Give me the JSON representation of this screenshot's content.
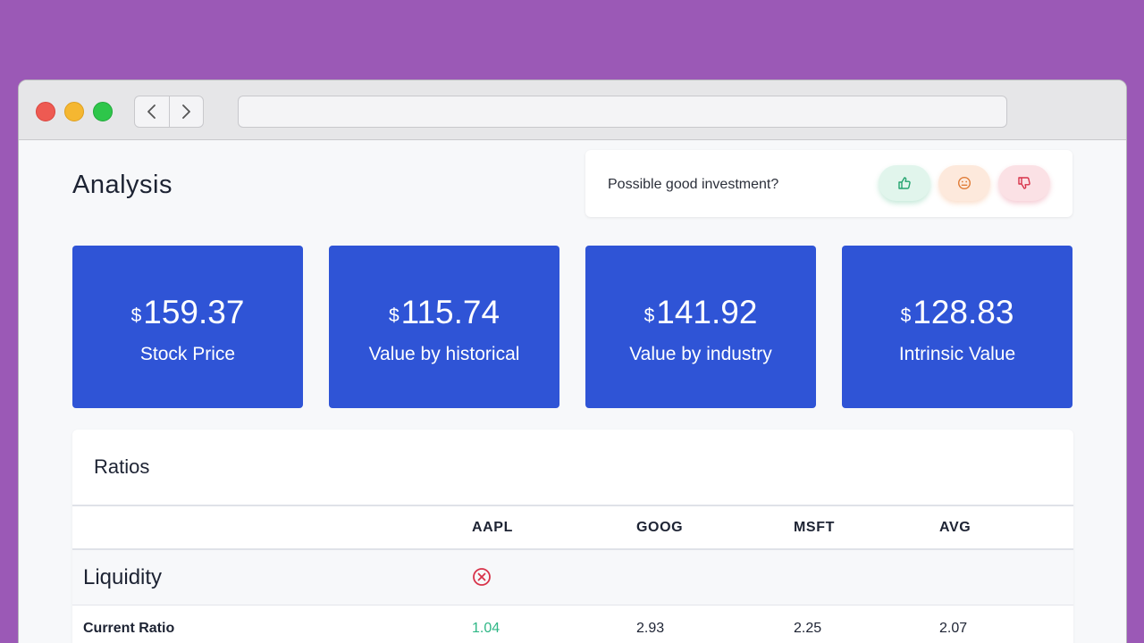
{
  "browser": {
    "url": ""
  },
  "page": {
    "title": "Analysis"
  },
  "feedback": {
    "question": "Possible good investment?",
    "buttons": [
      "thumbs-up",
      "neutral-face",
      "thumbs-down"
    ]
  },
  "cards": [
    {
      "currency": "$",
      "value": "159.37",
      "label": "Stock Price"
    },
    {
      "currency": "$",
      "value": "115.74",
      "label": "Value by historical"
    },
    {
      "currency": "$",
      "value": "141.92",
      "label": "Value by industry"
    },
    {
      "currency": "$",
      "value": "128.83",
      "label": "Intrinsic Value"
    }
  ],
  "ratios": {
    "title": "Ratios",
    "columns": [
      "",
      "AAPL",
      "GOOG",
      "MSFT",
      "AVG"
    ],
    "section": {
      "label": "Liquidity",
      "status_icon": "x-circle-icon"
    },
    "rows": [
      {
        "name": "Current Ratio",
        "aapl": "1.04",
        "goog": "2.93",
        "msft": "2.25",
        "avg": "2.07"
      }
    ]
  },
  "colors": {
    "background": "#9b59b6",
    "card": "#2f54d6",
    "positive": "#2fb786",
    "negative": "#d8334a"
  }
}
